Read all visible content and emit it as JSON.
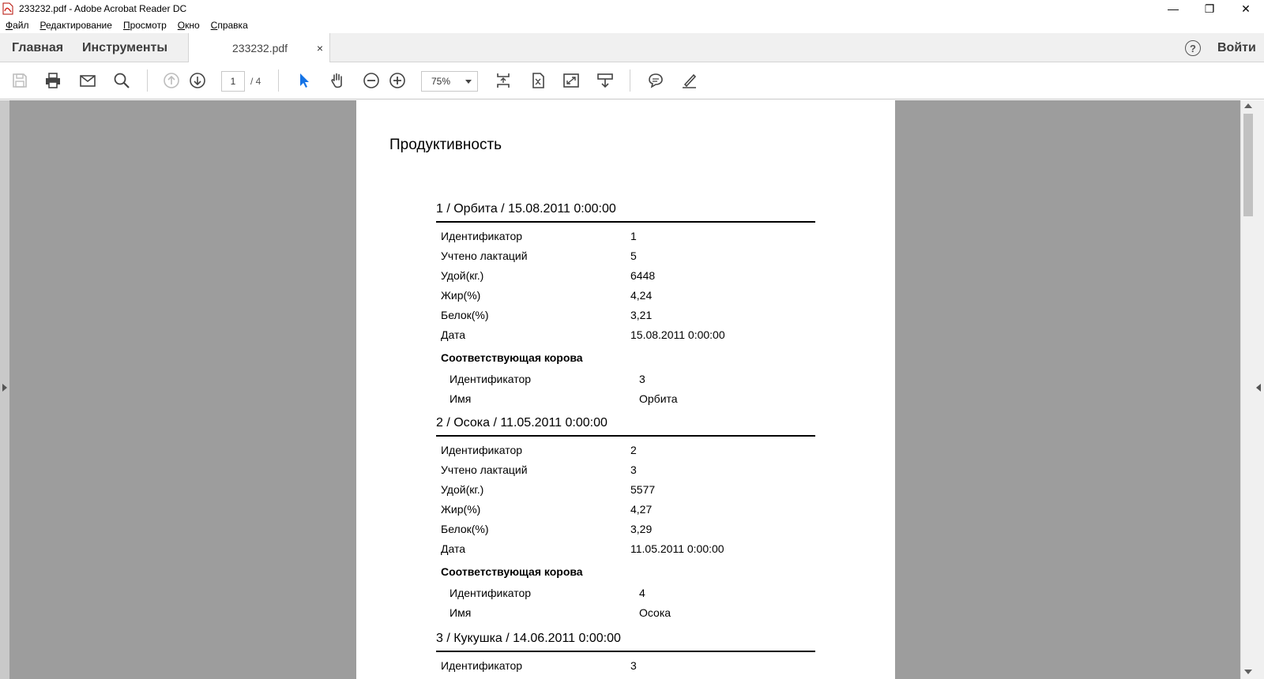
{
  "window": {
    "title": "233232.pdf - Adobe Acrobat Reader DC",
    "controls": [
      "—",
      "❐",
      "✕"
    ]
  },
  "menu": [
    {
      "u": "Ф",
      "rest": "айл"
    },
    {
      "u": "Р",
      "rest": "едактирование"
    },
    {
      "u": "П",
      "rest": "росмотр"
    },
    {
      "u": "О",
      "rest": "кно"
    },
    {
      "u": "С",
      "rest": "правка"
    }
  ],
  "tabs": {
    "home": "Главная",
    "tools": "Инструменты",
    "document": "233232.pdf",
    "close": "×",
    "help": "?",
    "login": "Войти"
  },
  "toolbar": {
    "page_current": "1",
    "page_total": "/ 4",
    "zoom": "75%",
    "icons": [
      "save-icon",
      "print-icon",
      "email-icon",
      "search-icon",
      "prev-page-icon",
      "next-page-icon",
      "select-tool-icon",
      "hand-tool-icon",
      "zoom-out-icon",
      "zoom-in-icon",
      "scroll-mode-icon",
      "fit-page-icon",
      "full-screen-icon",
      "read-mode-icon",
      "comment-icon",
      "sign-icon"
    ]
  },
  "document": {
    "title": "Продуктивность",
    "records": [
      {
        "heading": "1 / Орбита / 15.08.2011 0:00:00",
        "fields": [
          {
            "k": "Идентификатор",
            "v": "1"
          },
          {
            "k": "Учтено лактаций",
            "v": "5"
          },
          {
            "k": "Удой(кг.)",
            "v": "6448"
          },
          {
            "k": "Жир(%)",
            "v": "4,24"
          },
          {
            "k": "Белок(%)",
            "v": "3,21"
          },
          {
            "k": "Дата",
            "v": "15.08.2011 0:00:00"
          }
        ],
        "sub_heading": "Соответствующая корова",
        "sub_fields": [
          {
            "k": "Идентификатор",
            "v": "3"
          },
          {
            "k": "Имя",
            "v": "Орбита"
          }
        ]
      },
      {
        "heading": "2 / Осока / 11.05.2011 0:00:00",
        "fields": [
          {
            "k": "Идентификатор",
            "v": "2"
          },
          {
            "k": "Учтено лактаций",
            "v": "3"
          },
          {
            "k": "Удой(кг.)",
            "v": "5577"
          },
          {
            "k": "Жир(%)",
            "v": "4,27"
          },
          {
            "k": "Белок(%)",
            "v": "3,29"
          },
          {
            "k": "Дата",
            "v": "11.05.2011 0:00:00"
          }
        ],
        "sub_heading": "Соответствующая корова",
        "sub_fields": [
          {
            "k": "Идентификатор",
            "v": "4"
          },
          {
            "k": "Имя",
            "v": "Осока"
          }
        ]
      },
      {
        "heading": "3 / Кукушка / 14.06.2011 0:00:00",
        "fields": [
          {
            "k": "Идентификатор",
            "v": "3"
          }
        ]
      }
    ]
  }
}
